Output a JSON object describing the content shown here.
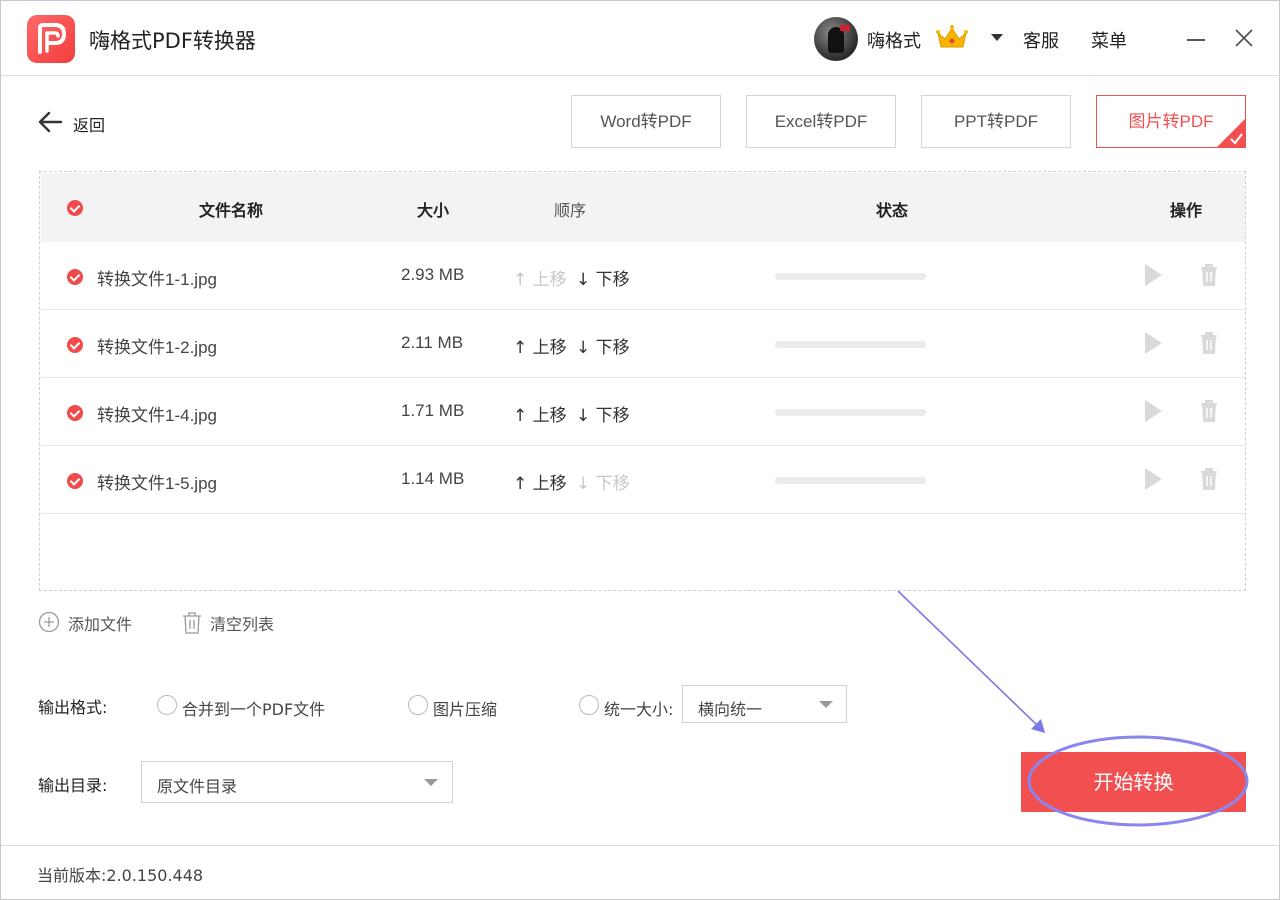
{
  "app": {
    "title": "嗨格式PDF转换器",
    "username": "嗨格式",
    "service_label": "客服",
    "menu_label": "菜单",
    "brand_color": "#f25050"
  },
  "toolbar": {
    "back_label": "返回",
    "tabs": [
      {
        "label": "Word转PDF",
        "active": false
      },
      {
        "label": "Excel转PDF",
        "active": false
      },
      {
        "label": "PPT转PDF",
        "active": false
      },
      {
        "label": "图片转PDF",
        "active": true
      }
    ]
  },
  "table": {
    "headers": {
      "name": "文件名称",
      "size": "大小",
      "order": "顺序",
      "status": "状态",
      "actions": "操作"
    },
    "move_up_label": "上移",
    "move_down_label": "下移",
    "rows": [
      {
        "name": "转换文件1-1.jpg",
        "size": "2.93 MB",
        "checked": true,
        "up_enabled": false,
        "down_enabled": true,
        "progress": 0
      },
      {
        "name": "转换文件1-2.jpg",
        "size": "2.11 MB",
        "checked": true,
        "up_enabled": true,
        "down_enabled": true,
        "progress": 0
      },
      {
        "name": "转换文件1-4.jpg",
        "size": "1.71 MB",
        "checked": true,
        "up_enabled": true,
        "down_enabled": true,
        "progress": 0
      },
      {
        "name": "转换文件1-5.jpg",
        "size": "1.14 MB",
        "checked": true,
        "up_enabled": true,
        "down_enabled": false,
        "progress": 0
      }
    ]
  },
  "list_actions": {
    "add_file": "添加文件",
    "clear_list": "清空列表"
  },
  "output": {
    "format_label": "输出格式:",
    "option_merge": "合并到一个PDF文件",
    "option_compress": "图片压缩",
    "option_unify": "统一大小:",
    "unify_value": "横向统一",
    "dir_label": "输出目录:",
    "dir_value": "原文件目录"
  },
  "start_button": "开始转换",
  "footer": {
    "version": "当前版本:2.0.150.448"
  },
  "icons": [
    "app-logo-icon",
    "crown-icon",
    "back-arrow-icon",
    "check-icon",
    "play-icon",
    "trash-icon",
    "add-circle-icon",
    "clear-trash-icon",
    "close-icon",
    "minimize-icon"
  ]
}
